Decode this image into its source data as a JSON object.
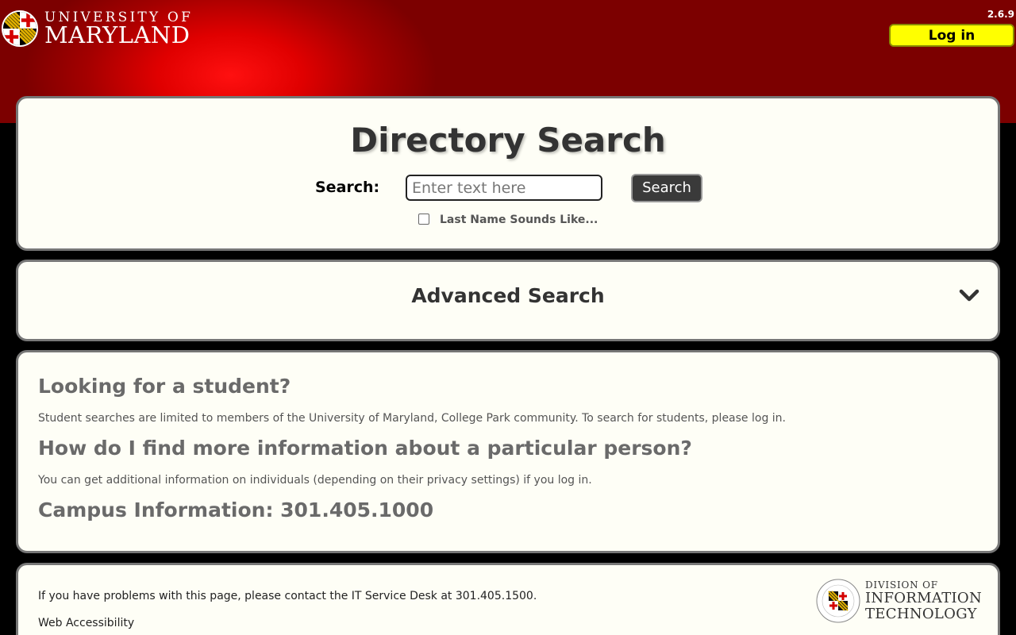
{
  "header": {
    "logo_line1": "UNIVERSITY OF",
    "logo_line2": "MARYLAND",
    "version": "2.6.9",
    "login_label": "Log in"
  },
  "search": {
    "title": "Directory Search",
    "label": "Search:",
    "placeholder": "Enter text here",
    "button_label": "Search",
    "soundex_label": "Last Name Sounds Like..."
  },
  "advanced": {
    "title": "Advanced Search"
  },
  "info": {
    "student_heading": "Looking for a student?",
    "student_text": "Student searches are limited to members of the University of Maryland, College Park community. To search for students, please log in.",
    "person_heading": "How do I find more information about a particular person?",
    "person_text": "You can get additional information on individuals (depending on their privacy settings) if you log in.",
    "campus_heading": "Campus Information: 301.405.1000"
  },
  "footer": {
    "help_text": "If you have problems with this page, please contact the IT Service Desk at 301.405.1500.",
    "accessibility_link": "Web Accessibility",
    "doit_line1": "DIVISION OF",
    "doit_line2": "INFORMATION",
    "doit_line3": "TECHNOLOGY"
  },
  "colors": {
    "banner_red": "#e00000",
    "login_yellow": "#ffff00",
    "panel_bg": "#fefef6"
  }
}
